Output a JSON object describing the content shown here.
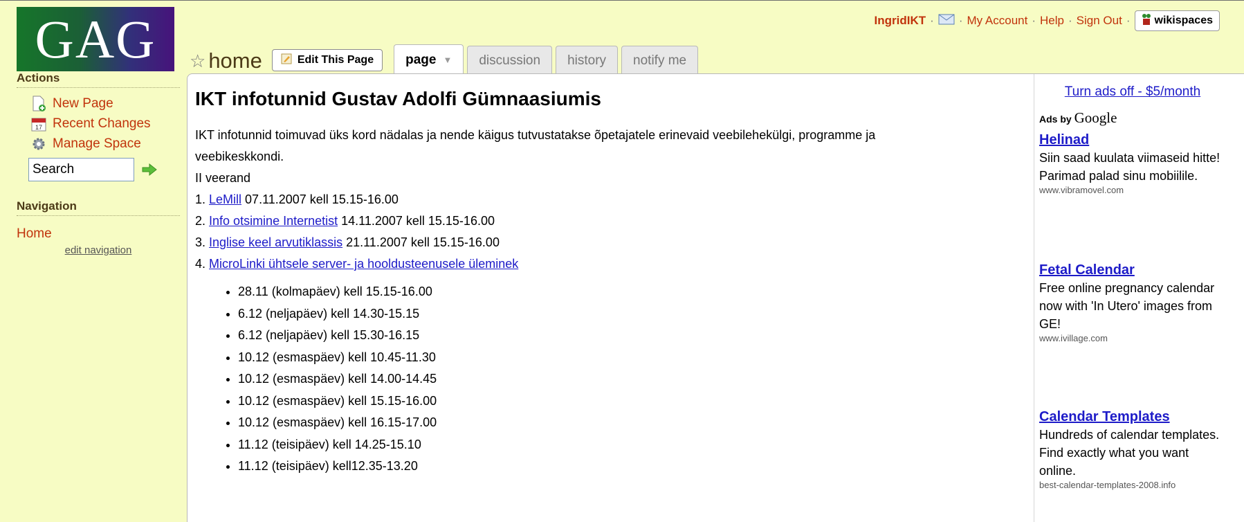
{
  "logo": {
    "text": "GAG"
  },
  "userbar": {
    "user": "IngridIKT",
    "my_account": "My Account",
    "help": "Help",
    "sign_out": "Sign Out",
    "wikispaces": "wikispaces"
  },
  "sidebar": {
    "actions_heading": "Actions",
    "actions": [
      {
        "label": "New Page",
        "icon": "new-page-icon"
      },
      {
        "label": "Recent Changes",
        "icon": "calendar-icon"
      },
      {
        "label": "Manage Space",
        "icon": "gear-icon"
      }
    ],
    "search_value": "Search",
    "navigation_heading": "Navigation",
    "home": "Home",
    "edit_navigation": "edit navigation"
  },
  "page": {
    "title": "home",
    "edit_button": "Edit This Page",
    "tabs": [
      "page",
      "discussion",
      "history",
      "notify me"
    ]
  },
  "article": {
    "heading": "IKT infotunnid Gustav Adolfi Gümnaasiumis",
    "intro_line1": "IKT infotunnid toimuvad üks kord nädalas ja nende käigus tutvustatakse õpetajatele erinevaid veebilehekülgi, programme ja",
    "intro_line2": "veebikeskkondi.",
    "period": "II veerand",
    "items": [
      {
        "num": "1.",
        "link": "LeMill",
        "rest": " 07.11.2007 kell 15.15-16.00"
      },
      {
        "num": "2.",
        "link": "Info otsimine Internetist",
        "rest": " 14.11.2007 kell 15.15-16.00"
      },
      {
        "num": "3.",
        "link": "Inglise keel arvutiklassis",
        "rest": " 21.11.2007 kell 15.15-16.00"
      },
      {
        "num": "4.",
        "link": "MicroLinki ühtsele server- ja hooldusteenusele üleminek",
        "rest": ""
      }
    ],
    "sessions": [
      "28.11 (kolmapäev) kell 15.15-16.00",
      "6.12 (neljapäev) kell 14.30-15.15",
      "6.12 (neljapäev) kell 15.30-16.15",
      "10.12 (esmaspäev) kell 10.45-11.30",
      "10.12 (esmaspäev) kell 14.00-14.45",
      "10.12 (esmaspäev) kell 15.15-16.00",
      "10.12 (esmaspäev) kell 16.15-17.00",
      "11.12 (teisipäev) kell 14.25-15.10",
      "11.12 (teisipäev) kell12.35-13.20"
    ]
  },
  "ads": {
    "turn_off": "Turn ads off - $5/month",
    "ads_by": "Ads by",
    "google": "Google",
    "items": [
      {
        "title": "Helinad",
        "body": "Siin saad kuulata viimaseid hitte! Parimad palad sinu mobiilile.",
        "url": "www.vibramovel.com"
      },
      {
        "title": "Fetal Calendar",
        "body": "Free online pregnancy calendar now with 'In Utero' images from GE!",
        "url": "www.ivillage.com"
      },
      {
        "title": "Calendar Templates",
        "body": "Hundreds of calendar templates. Find exactly what you want online.",
        "url": "best-calendar-templates-2008.info"
      }
    ]
  }
}
